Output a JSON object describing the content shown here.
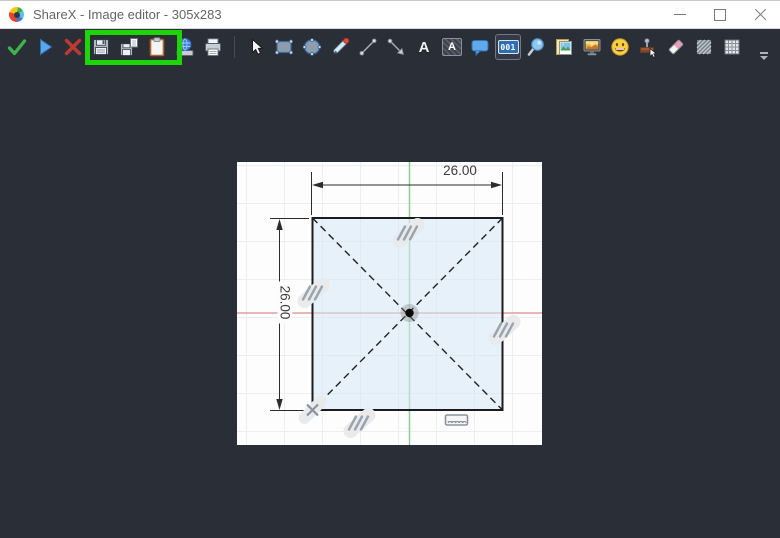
{
  "window": {
    "title": "ShareX - Image editor - 305x283",
    "app_icon": "sharex-logo",
    "controls": [
      {
        "name": "minimize",
        "icon": "minimize-icon"
      },
      {
        "name": "maximize",
        "icon": "maximize-icon"
      },
      {
        "name": "close",
        "icon": "close-icon"
      }
    ]
  },
  "toolbar": {
    "step_label": "001",
    "text_glyph": "A",
    "selected_tool": "step-counter",
    "items": [
      {
        "name": "accept",
        "icon": "check-icon"
      },
      {
        "name": "continue",
        "icon": "play-icon"
      },
      {
        "name": "cancel",
        "icon": "cross-icon"
      },
      {
        "name": "save",
        "icon": "save-icon"
      },
      {
        "name": "save-as",
        "icon": "save-as-icon"
      },
      {
        "name": "copy-to-clipboard",
        "icon": "clipboard-icon"
      },
      {
        "name": "upload",
        "icon": "globe-upload-icon"
      },
      {
        "name": "print",
        "icon": "printer-icon"
      },
      {
        "name": "select",
        "icon": "cursor-icon"
      },
      {
        "name": "rectangle",
        "icon": "rectangle-icon"
      },
      {
        "name": "ellipse",
        "icon": "ellipse-icon"
      },
      {
        "name": "freehand",
        "icon": "pencil-icon"
      },
      {
        "name": "line",
        "icon": "line-icon"
      },
      {
        "name": "arrow",
        "icon": "arrow-icon"
      },
      {
        "name": "text-outline",
        "icon": "text-icon"
      },
      {
        "name": "text-background",
        "icon": "text-background-icon"
      },
      {
        "name": "speech-balloon",
        "icon": "speech-balloon-icon"
      },
      {
        "name": "step-counter",
        "icon": "step-001-icon"
      },
      {
        "name": "magnify",
        "icon": "magnifier-icon"
      },
      {
        "name": "image-file",
        "icon": "image-file-icon"
      },
      {
        "name": "image-screen",
        "icon": "monitor-image-icon"
      },
      {
        "name": "emoji",
        "icon": "smiley-icon"
      },
      {
        "name": "cursor-sticker",
        "icon": "stamp-cursor-icon"
      },
      {
        "name": "eraser",
        "icon": "eraser-icon"
      },
      {
        "name": "blur",
        "icon": "blur-icon"
      },
      {
        "name": "pixelate",
        "icon": "pixelate-icon"
      }
    ]
  },
  "annotation": {
    "highlight_color": "#1ED50A",
    "highlighted_tools": [
      "save",
      "save-as",
      "copy-to-clipboard"
    ]
  },
  "canvas": {
    "image": {
      "dimensions": {
        "horizontal": "26.00",
        "vertical": "26.00"
      },
      "axis_colors": {
        "vertical": "#8FD08F",
        "horizontal": "#E08A8A"
      },
      "sketch_fill": "#E9F2FA"
    }
  },
  "colors": {
    "titlebar_bg": "#FFFFFF",
    "editor_bg": "#2A2E36",
    "selected_tool_border": "#717887"
  }
}
